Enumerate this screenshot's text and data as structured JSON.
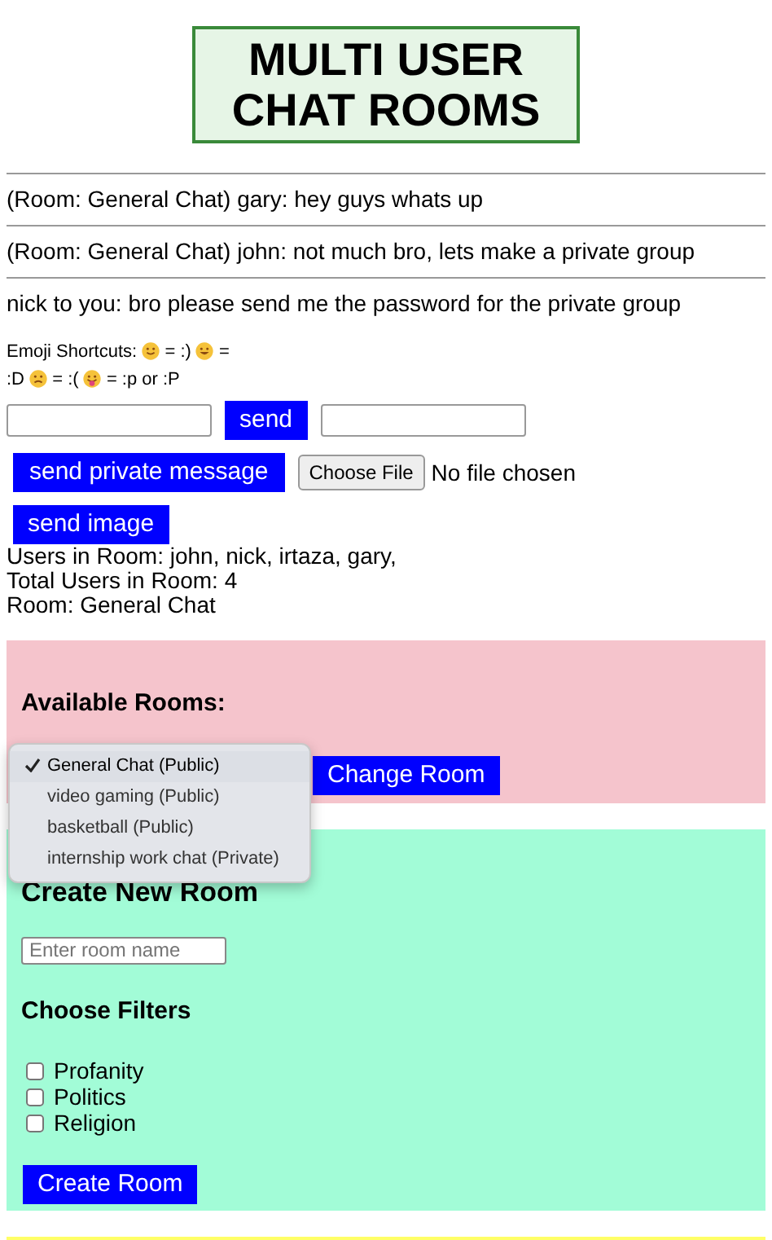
{
  "title_lines": [
    "MULTI USER",
    "CHAT ROOMS"
  ],
  "messages": [
    "(Room: General Chat) gary: hey guys whats up",
    "(Room: General Chat) john: not much bro, lets make a private group",
    "nick to you: bro please send me the password for the private group"
  ],
  "emoji_shortcuts": {
    "label": "Emoji Shortcuts:",
    "items": [
      {
        "kind": "smile",
        "code": "= :)"
      },
      {
        "kind": "grin",
        "code": "= :D"
      },
      {
        "kind": "sad",
        "code": "= :("
      },
      {
        "kind": "tongue",
        "code": "= :p or :P"
      }
    ]
  },
  "send_button": "send",
  "private_button": "send private message",
  "file_button": "Choose File",
  "file_status": "No file chosen",
  "image_button": "send image",
  "room_info": [
    "Users in Room: john, nick, irtaza, gary,",
    "Total Users in Room: 4",
    "Room: General Chat"
  ],
  "available_rooms": {
    "heading": "Available Rooms:",
    "options": [
      {
        "label": "General Chat (Public)",
        "selected": true
      },
      {
        "label": "video gaming (Public)",
        "selected": false
      },
      {
        "label": "basketball (Public)",
        "selected": false
      },
      {
        "label": "internship work chat (Private)",
        "selected": false
      }
    ],
    "button": "Change Room"
  },
  "create_room": {
    "heading": "Create New Room",
    "placeholder": "Enter room name",
    "filters_heading": "Choose Filters",
    "filters": [
      {
        "label": "Profanity",
        "checked": false
      },
      {
        "label": "Politics",
        "checked": false
      },
      {
        "label": "Religion",
        "checked": false
      }
    ],
    "button": "Create Room"
  }
}
